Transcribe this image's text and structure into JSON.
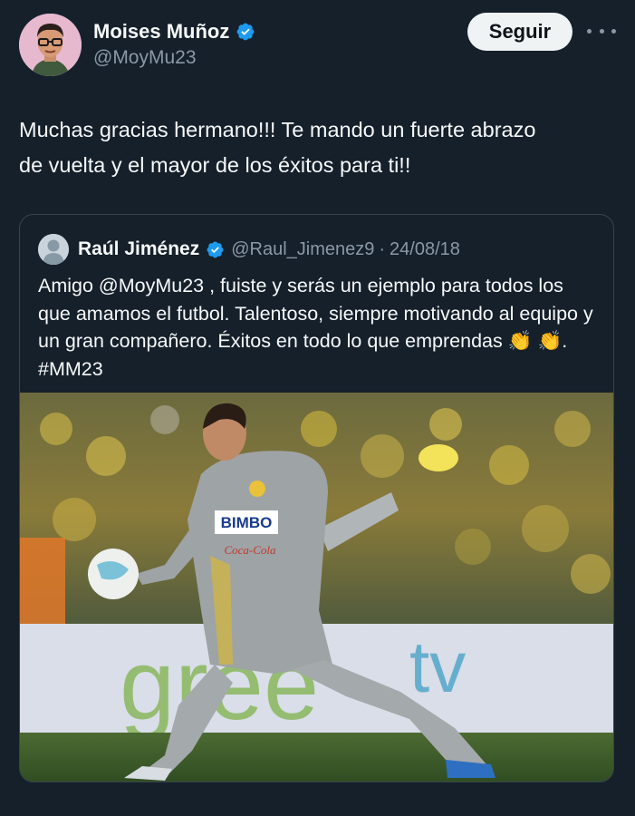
{
  "tweet": {
    "author": {
      "display_name": "Moises Muñoz",
      "handle": "@MoyMu23",
      "verified": true,
      "avatar_icon": "avatar-caricature"
    },
    "follow_label": "Seguir",
    "more_icon": "ellipsis-icon",
    "text": "Muchas gracias hermano!!! Te mando un fuerte abrazo\nde vuelta y el mayor de los éxitos para ti!!"
  },
  "quoted": {
    "author": {
      "display_name": "Raúl Jiménez",
      "handle": "@Raul_Jimenez9",
      "verified": true,
      "avatar_icon": "default-avatar"
    },
    "separator": "·",
    "date": "24/08/18",
    "text_before_emoji": "Amigo @MoyMu23 , fuiste y serás un ejemplo para todos los que amamos el futbol. Talentoso, siempre motivando al equipo y un gran compañero. Éxitos en todo lo que emprendas ",
    "emoji": "👏 👏",
    "text_after_emoji": ". #MM23",
    "media": {
      "alt_kind": "photo",
      "jersey_sponsor": "BIMBO",
      "jersey_sub": "Coca-Cola",
      "banner_text": "green tv"
    }
  },
  "colors": {
    "background": "#15202b",
    "text_primary": "#f7f9f9",
    "text_secondary": "#8b98a5",
    "verified_blue": "#1d9bf0",
    "border": "#38444d",
    "follow_bg": "#eff3f4"
  }
}
